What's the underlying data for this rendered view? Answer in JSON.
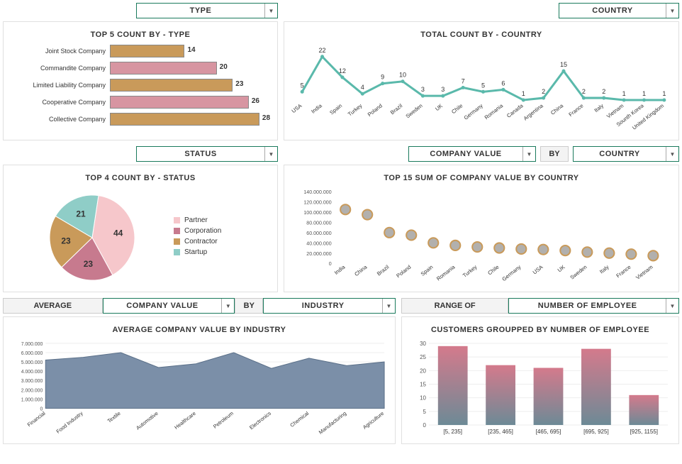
{
  "chart_data": [
    {
      "id": "type_bar",
      "type": "bar",
      "orientation": "horizontal",
      "title": "TOP 5 COUNT BY - TYPE",
      "categories": [
        "Joint Stock Company",
        "Commandite Company",
        "Limited Liability Company",
        "Cooperative Company",
        "Collective Company"
      ],
      "values": [
        14,
        20,
        23,
        26,
        28
      ],
      "xlim": [
        0,
        30
      ]
    },
    {
      "id": "country_line",
      "type": "line",
      "title": "TOTAL COUNT BY - COUNTRY",
      "categories": [
        "USA",
        "India",
        "Spain",
        "Turkey",
        "Poland",
        "Brazil",
        "Sweden",
        "UK",
        "Chile",
        "Germany",
        "Romania",
        "Canada",
        "Argentina",
        "China",
        "France",
        "Italy",
        "Vietnam",
        "Sounth Korea",
        "United Kingdom"
      ],
      "values": [
        5,
        22,
        12,
        4,
        9,
        10,
        3,
        3,
        7,
        5,
        6,
        1,
        2,
        15,
        2,
        2,
        1,
        1,
        1
      ],
      "ylim": [
        0,
        25
      ]
    },
    {
      "id": "status_pie",
      "type": "pie",
      "title": "TOP 4 COUNT BY - STATUS",
      "series": [
        {
          "name": "Partner",
          "value": 44,
          "color": "#f6c7cb"
        },
        {
          "name": "Corporation",
          "value": 23,
          "color": "#c77a8e"
        },
        {
          "name": "Contractor",
          "value": 23,
          "color": "#c99a5a"
        },
        {
          "name": "Startup",
          "value": 21,
          "color": "#8fcdc7"
        }
      ]
    },
    {
      "id": "value_by_country",
      "type": "scatter",
      "title": "TOP 15 SUM OF COMPANY VALUE BY COUNTRY",
      "categories": [
        "India",
        "China",
        "Brazil",
        "Poland",
        "Spain",
        "Romania",
        "Turkey",
        "Chile",
        "Germany",
        "USA",
        "UK",
        "Sweden",
        "Italy",
        "France",
        "Vietnam"
      ],
      "values": [
        105000000,
        95000000,
        60000000,
        55000000,
        40000000,
        35000000,
        32000000,
        30000000,
        28000000,
        27000000,
        25000000,
        22000000,
        20000000,
        18000000,
        15000000
      ],
      "ylim": [
        0,
        140000000
      ],
      "yticks": [
        0,
        20000000,
        40000000,
        60000000,
        80000000,
        100000000,
        120000000,
        140000000
      ],
      "ytick_labels": [
        "0",
        "20.000.000",
        "40.000.000",
        "60.000.000",
        "80.000.000",
        "100.000.000",
        "120.000.000",
        "140.000.000"
      ]
    },
    {
      "id": "avg_by_industry",
      "type": "area",
      "title": "AVERAGE COMPANY VALUE BY INDUSTRY",
      "categories": [
        "Financial",
        "Food Industry",
        "Textile",
        "Automotive",
        "Healthcare",
        "Petroleum",
        "Electronics",
        "Chemical",
        "Manufacturing",
        "Agriculture"
      ],
      "values": [
        5200000,
        5500000,
        6000000,
        4400000,
        4800000,
        6000000,
        4300000,
        5400000,
        4600000,
        5000000
      ],
      "ylim": [
        0,
        7000000
      ],
      "yticks": [
        0,
        1000000,
        2000000,
        3000000,
        4000000,
        5000000,
        6000000,
        7000000
      ],
      "ytick_labels": [
        "0",
        "1.000.000",
        "2.000.000",
        "3.000.000",
        "4.000.000",
        "5.000.000",
        "6.000.000",
        "7.000.000"
      ]
    },
    {
      "id": "employee_hist",
      "type": "bar",
      "title": "CUSTOMERS GROUPPED BY NUMBER OF EMPLOYEE",
      "categories": [
        "[5, 235]",
        "[235, 465]",
        "[465, 695]",
        "[695, 925]",
        "[925, 1155]"
      ],
      "values": [
        29,
        22,
        21,
        28,
        11
      ],
      "ylim": [
        0,
        30
      ],
      "yticks": [
        0,
        5,
        10,
        15,
        20,
        25,
        30
      ]
    }
  ],
  "dropdowns": {
    "type": "TYPE",
    "status": "STATUS",
    "country": "COUNTRY",
    "country2": "COUNTRY",
    "company_value": "COMPANY VALUE",
    "company_value2": "COMPANY VALUE",
    "industry": "INDUSTRY",
    "num_employee": "NUMBER OF EMPLOYEE"
  },
  "labels": {
    "by": "BY",
    "by2": "BY",
    "average": "AVERAGE",
    "range_of": "RANGE OF"
  },
  "colors": {
    "pink": "#d795a1",
    "tan": "#c99a5a",
    "teal": "#5ab9ab",
    "gray": "#b2b0ad",
    "slate": "#7b8fa8"
  }
}
